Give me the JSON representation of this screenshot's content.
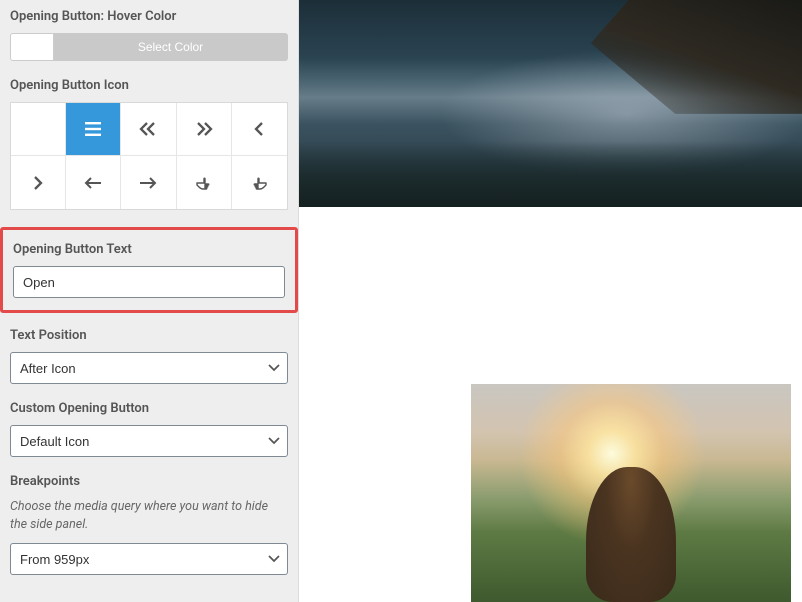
{
  "hoverColor": {
    "label": "Opening Button: Hover Color",
    "buttonLabel": "Select Color"
  },
  "iconSection": {
    "label": "Opening Button Icon"
  },
  "buttonText": {
    "label": "Opening Button Text",
    "value": "Open"
  },
  "textPosition": {
    "label": "Text Position",
    "value": "After Icon"
  },
  "customButton": {
    "label": "Custom Opening Button",
    "value": "Default Icon"
  },
  "breakpoints": {
    "label": "Breakpoints",
    "help": "Choose the media query where you want to hide the side panel.",
    "value": "From 959px"
  }
}
